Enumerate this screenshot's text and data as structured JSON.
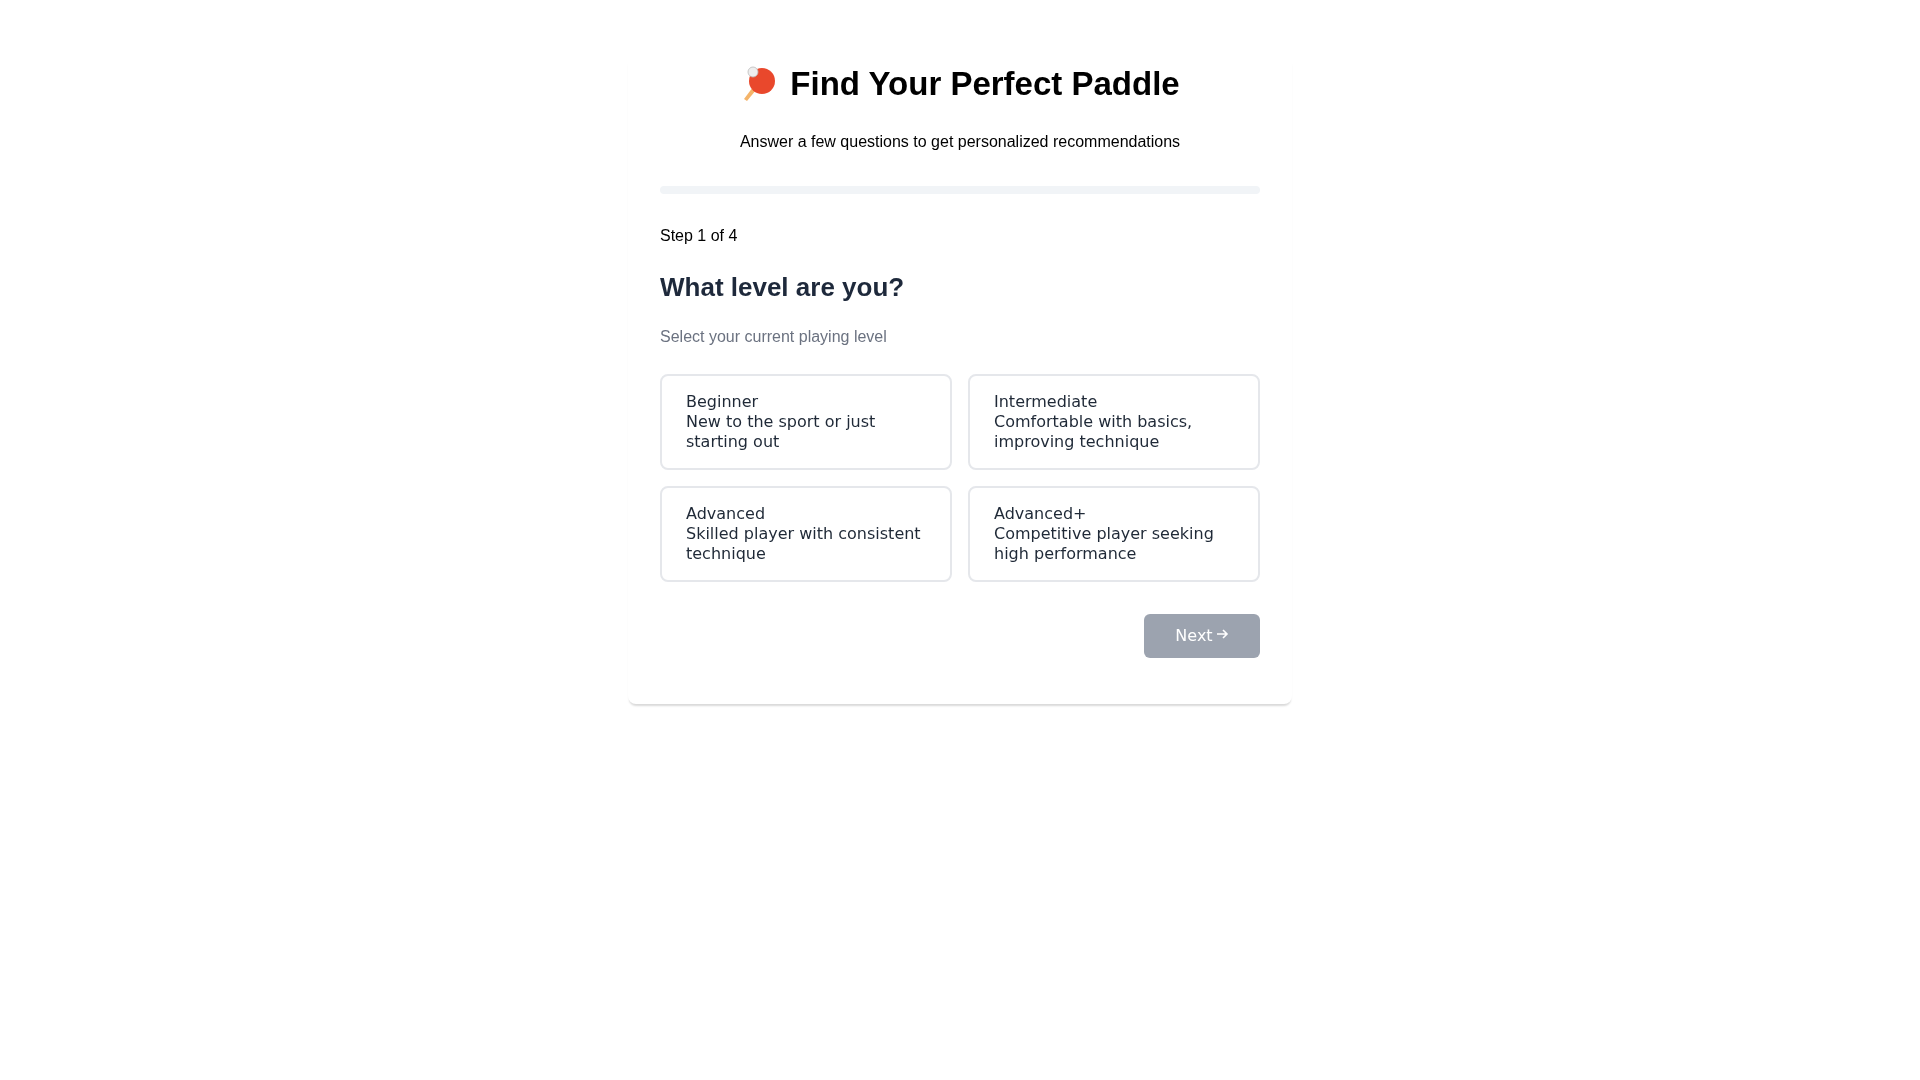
{
  "header": {
    "title": "Find Your Perfect Paddle",
    "subtitle": "Answer a few questions to get personalized recommendations"
  },
  "progress": {
    "level": 0
  },
  "step": {
    "label": "Step 1 of 4",
    "question": "What level are you?",
    "hint": "Select your current playing level"
  },
  "options": [
    {
      "title": "Beginner",
      "description": "New to the sport or just starting out",
      "selected": false
    },
    {
      "title": "Intermediate",
      "description": "Comfortable with basics, improving technique",
      "selected": false
    },
    {
      "title": "Advanced",
      "description": "Skilled player with consistent technique",
      "selected": false
    },
    {
      "title": "Advanced+",
      "description": "Competitive player seeking high performance",
      "selected": false
    }
  ],
  "next_button": {
    "label": "Next",
    "disabled": true
  }
}
